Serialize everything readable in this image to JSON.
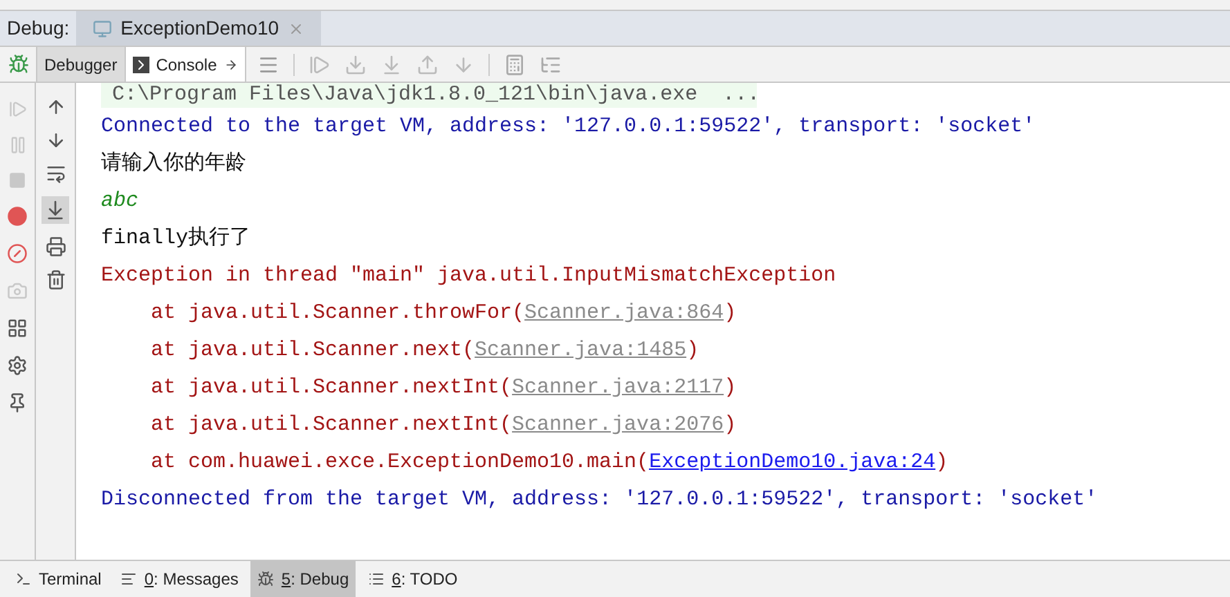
{
  "debug_bar": {
    "label": "Debug:",
    "tab": {
      "title": "ExceptionDemo10",
      "selected": true
    }
  },
  "toolbar": {
    "tabs": [
      {
        "label": "Debugger",
        "selected": false
      },
      {
        "label": "Console",
        "selected": true
      }
    ]
  },
  "console": {
    "command": "C:\\Program Files\\Java\\jdk1.8.0_121\\bin\\java.exe  ...",
    "lines": [
      {
        "kind": "system",
        "text": "Connected to the target VM, address: '127.0.0.1:59522', transport: 'socket'"
      },
      {
        "kind": "output",
        "text": "请输入你的年龄"
      },
      {
        "kind": "input",
        "text": "abc"
      },
      {
        "kind": "output",
        "text": "finally执行了"
      },
      {
        "kind": "error",
        "text": "Exception in thread \"main\" java.util.InputMismatchException"
      },
      {
        "kind": "frame",
        "text": "at java.util.Scanner.throwFor(",
        "link": {
          "text": "Scanner.java:864",
          "kind": "library"
        },
        "suffix": ")"
      },
      {
        "kind": "frame",
        "text": "at java.util.Scanner.next(",
        "link": {
          "text": "Scanner.java:1485",
          "kind": "library"
        },
        "suffix": ")"
      },
      {
        "kind": "frame",
        "text": "at java.util.Scanner.nextInt(",
        "link": {
          "text": "Scanner.java:2117",
          "kind": "library"
        },
        "suffix": ")"
      },
      {
        "kind": "frame",
        "text": "at java.util.Scanner.nextInt(",
        "link": {
          "text": "Scanner.java:2076",
          "kind": "library"
        },
        "suffix": ")"
      },
      {
        "kind": "frame",
        "text": "at com.huawei.exce.ExceptionDemo10.main(",
        "link": {
          "text": "ExceptionDemo10.java:24",
          "kind": "project"
        },
        "suffix": ")"
      },
      {
        "kind": "system",
        "text": "Disconnected from the target VM, address: '127.0.0.1:59522', transport: 'socket'"
      }
    ]
  },
  "bottom_tabs": [
    {
      "label": "Terminal",
      "selected": false
    },
    {
      "label": "0: Messages",
      "selected": false
    },
    {
      "label": "5: Debug",
      "selected": true
    },
    {
      "label": "6: TODO",
      "selected": false
    }
  ]
}
